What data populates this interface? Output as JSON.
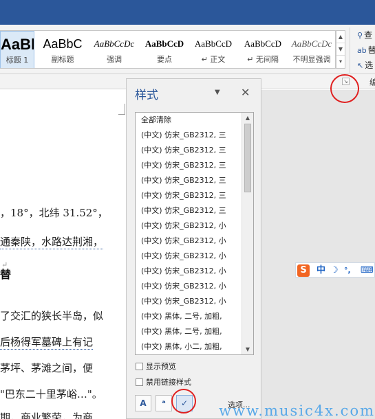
{
  "ribbon": {
    "styles": [
      {
        "preview": "AaBl",
        "name": "标题 1"
      },
      {
        "preview": "AaBbC",
        "name": "副标题"
      },
      {
        "preview": "AaBbCcDc",
        "name": "强调"
      },
      {
        "preview": "AaBbCcD",
        "name": "要点"
      },
      {
        "preview": "AaBbCcD",
        "name": "↵ 正文"
      },
      {
        "preview": "AaBbCcD",
        "name": "↵ 无间隔"
      },
      {
        "preview": "AaBbCcDc",
        "name": "不明显强调"
      }
    ],
    "editing": {
      "find": "查",
      "replace": "替",
      "select": "选",
      "group_label": "编"
    }
  },
  "document": {
    "lines": [
      "，18°，北纬 31.52°，",
      "通秦陕，水路达荆湘，",
      "",
      "替",
      "了交汇的狭长半岛，似",
      "后杨得军墓碑上有记",
      "茅坪、茅滩之间，便",
      "\"巴东二十里茅峪…\"。",
      "期，商业繁荣，为商"
    ]
  },
  "styles_pane": {
    "title": "样式",
    "items": [
      "全部清除",
      "(中文) 仿宋_GB2312, 三",
      "(中文) 仿宋_GB2312, 三",
      "(中文) 仿宋_GB2312, 三",
      "(中文) 仿宋_GB2312, 三",
      "(中文) 仿宋_GB2312, 三",
      "(中文) 仿宋_GB2312, 三",
      "(中文) 仿宋_GB2312, 小",
      "(中文) 仿宋_GB2312, 小",
      "(中文) 仿宋_GB2312, 小",
      "(中文) 仿宋_GB2312, 小",
      "(中文) 仿宋_GB2312, 小",
      "(中文) 仿宋_GB2312, 小",
      "(中文) 黑体, 二号, 加粗,",
      "(中文) 黑体, 二号, 加粗,",
      "(中文) 黑体, 小二, 加粗,"
    ],
    "show_preview": "显示预览",
    "disable_linked": "禁用链接样式",
    "options": "选项..."
  },
  "ime": {
    "logo": "S",
    "mode": "中",
    "moon": "☽",
    "punct": "°,",
    "keyboard": "⌨"
  },
  "watermark": "www.music4x.com"
}
